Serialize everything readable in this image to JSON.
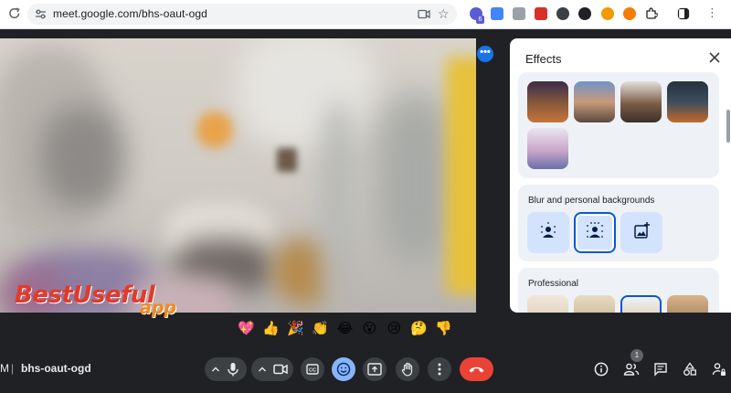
{
  "browser": {
    "url": "meet.google.com/bhs-oaut-ogd",
    "extension_badge": "6"
  },
  "effects_panel": {
    "title": "Effects",
    "blur_section_title": "Blur and personal backgrounds",
    "professional_section_title": "Professional"
  },
  "watermark": {
    "main": "BestUseful",
    "sub": "app"
  },
  "reactions": [
    "💖",
    "👍",
    "🎉",
    "👏",
    "😂",
    "😮",
    "😢",
    "🤔",
    "👎"
  ],
  "meeting": {
    "edge_text": "M",
    "separator": "|",
    "code": "bhs-oaut-ogd",
    "participant_count": "1"
  },
  "colors": {
    "accent_blue": "#1a73e8",
    "end_call_red": "#ea4335",
    "bar_background": "#202124",
    "control_grey": "#3c4043",
    "effects_active": "#8ab4f8"
  },
  "icons": {
    "reload": "reload-icon",
    "site_settings": "tune-icon",
    "camera_blocked": "camera-icon",
    "bookmark": "star-icon",
    "close": "close-icon",
    "mic": "mic-icon",
    "camera": "videocam-icon",
    "captions": "closed-captions-icon",
    "effects": "emoji-effects-icon",
    "present": "present-screen-icon",
    "raise_hand": "hand-icon",
    "more": "more-vert-icon",
    "end_call": "call-end-icon",
    "info": "info-icon",
    "people": "people-icon",
    "chat": "chat-icon",
    "activities": "shapes-icon",
    "host_controls": "lock-person-icon"
  }
}
